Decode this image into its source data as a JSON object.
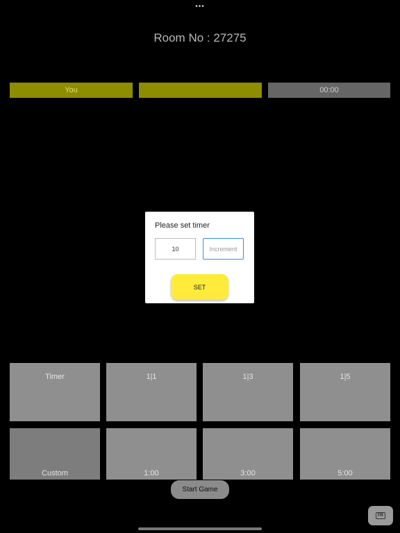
{
  "status": {
    "dots": "•••"
  },
  "header": {
    "room": "Room No : 27275"
  },
  "players": {
    "you_label": "You",
    "opponent_label": "",
    "clock": "00:00"
  },
  "dialog": {
    "title": "Please set timer",
    "minutes_value": "10",
    "increment_placeholder": "Increment",
    "set_label": "SET"
  },
  "presets": {
    "row1": [
      "Timer",
      "1|1",
      "1|3",
      "1|5"
    ],
    "row2": [
      "Custom",
      "1:00",
      "3:00",
      "5:00"
    ]
  },
  "actions": {
    "start_label": "Start Game",
    "keyboard_label": "FR"
  },
  "colors": {
    "accent_yellow": "#ffeb3b",
    "bar_olive": "#8d8d00",
    "field_focus": "#3a8fd6"
  }
}
